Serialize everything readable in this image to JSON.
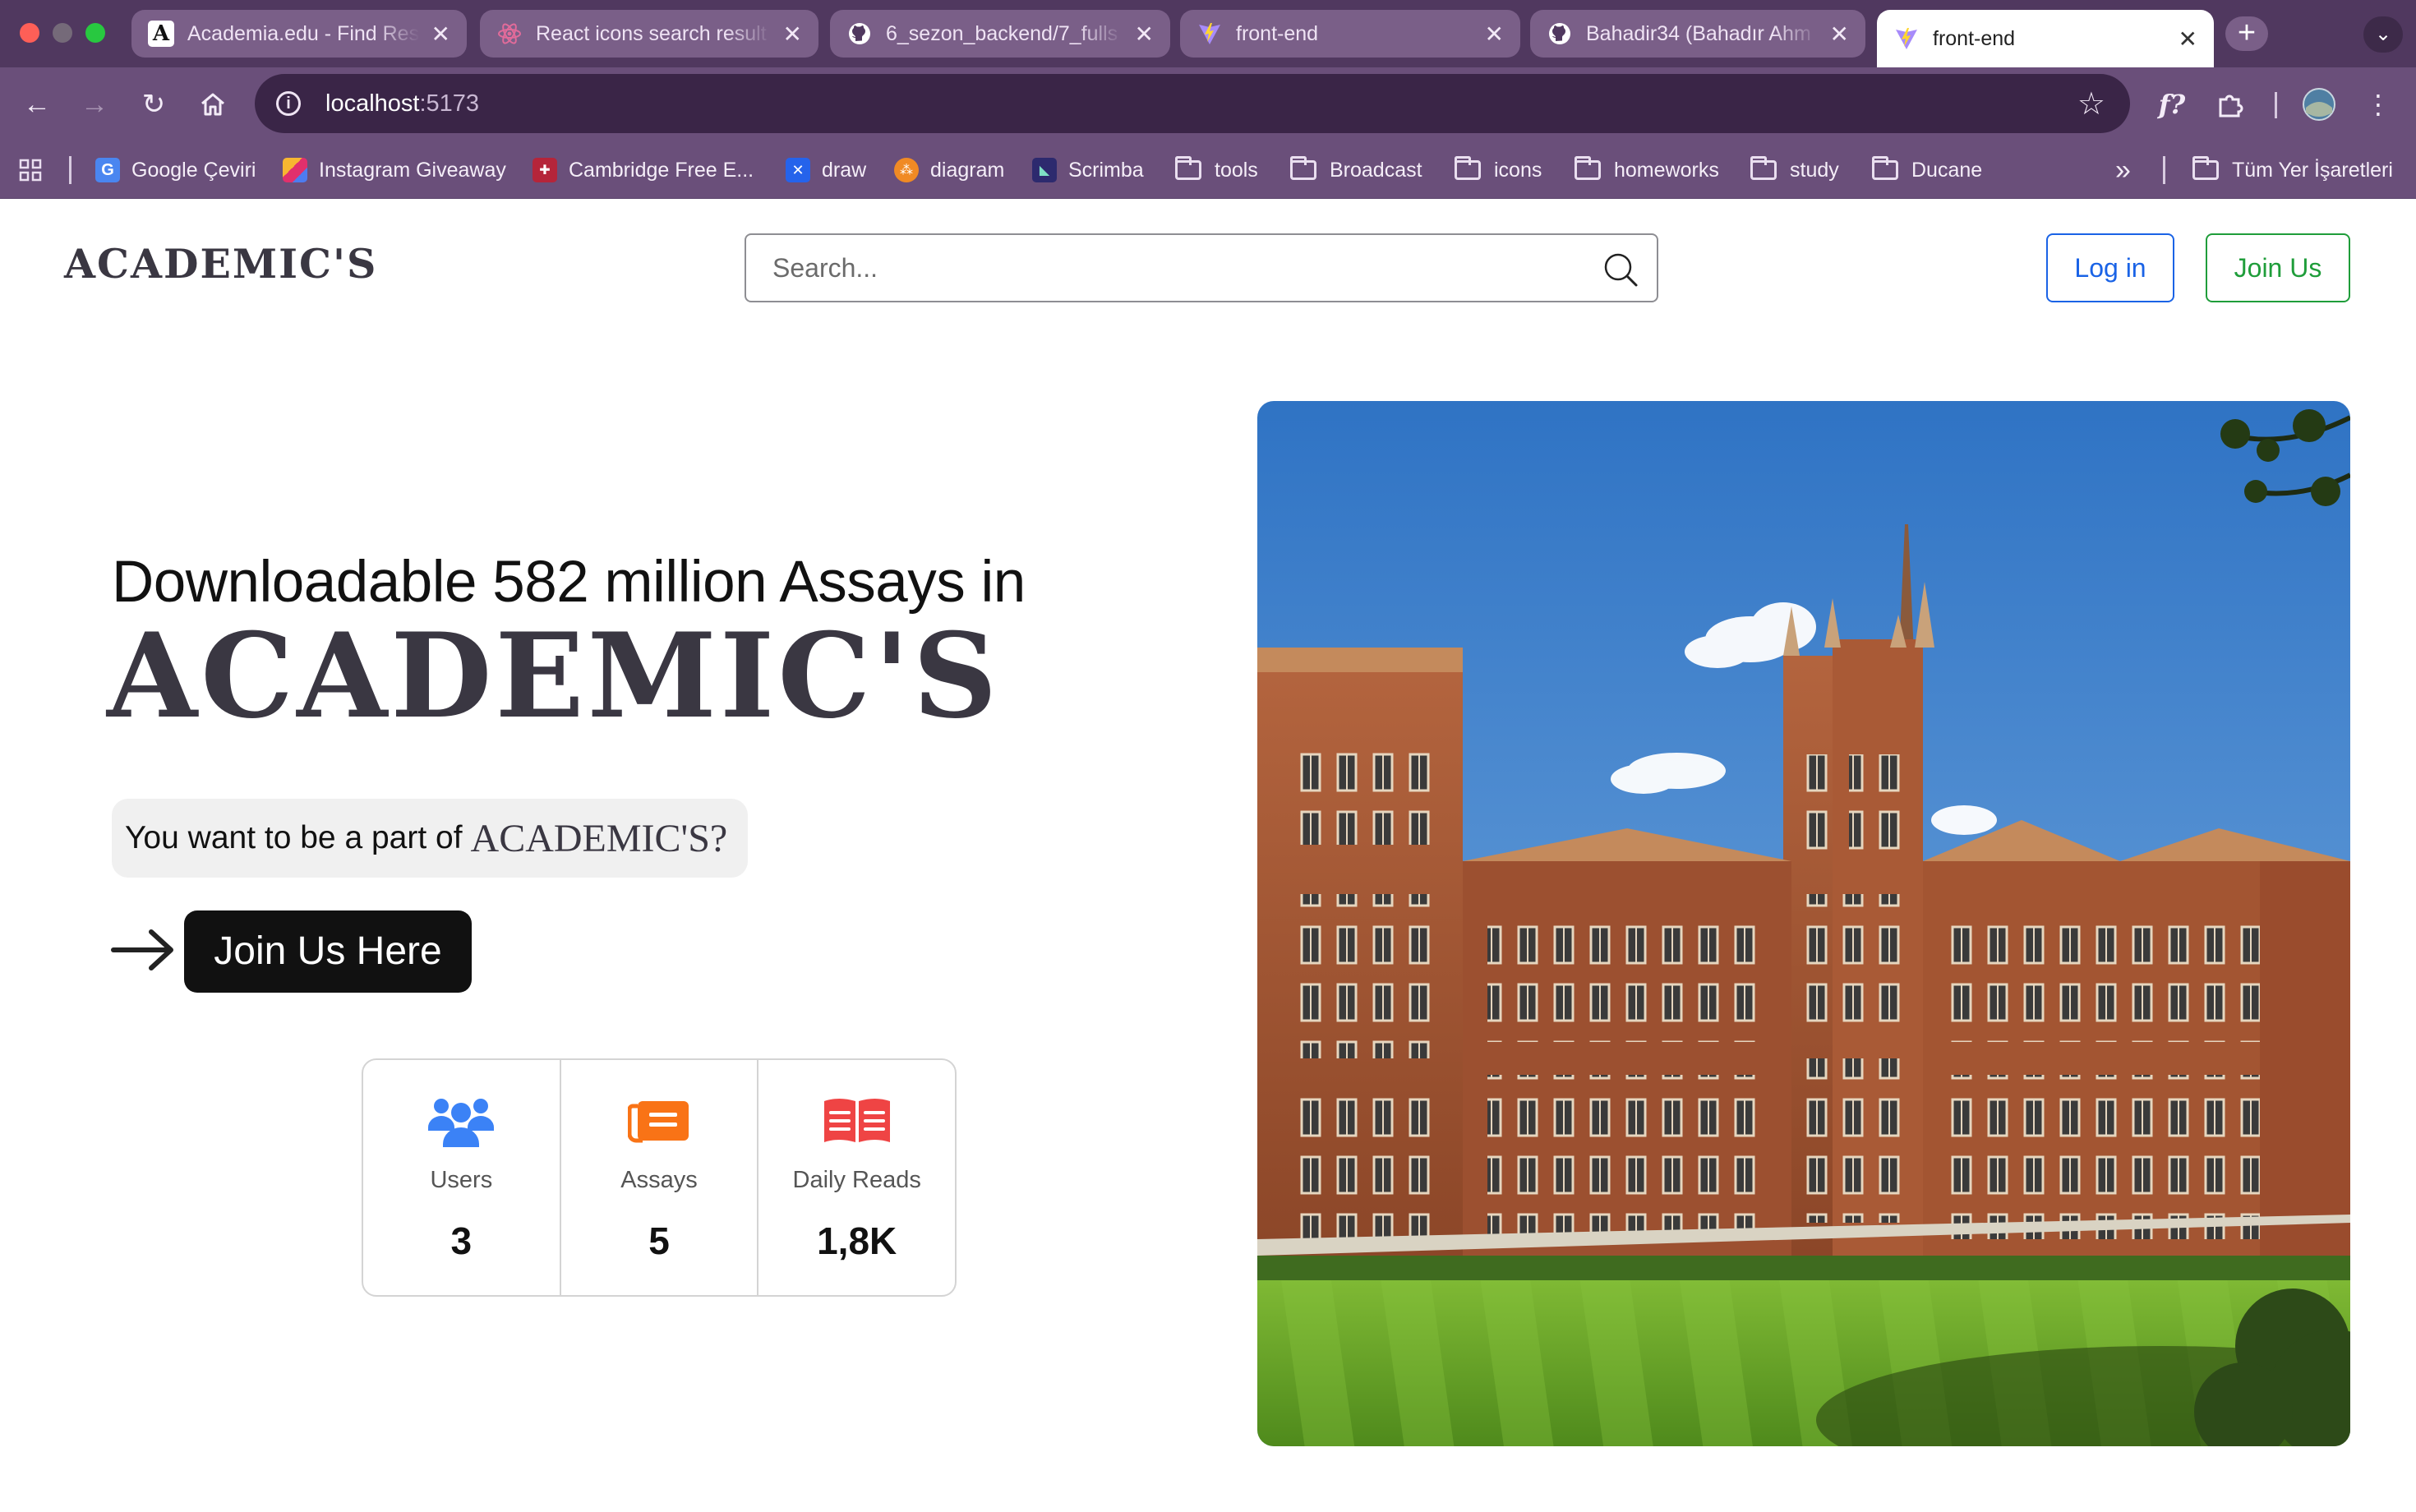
{
  "browser": {
    "tabs": [
      {
        "title": "Academia.edu - Find Res",
        "icon": "academia-icon"
      },
      {
        "title": "React icons search result",
        "icon": "react-icon"
      },
      {
        "title": "6_sezon_backend/7_fulls",
        "icon": "github-icon"
      },
      {
        "title": "front-end",
        "icon": "vite-icon"
      },
      {
        "title": "Bahadir34 (Bahadır Ahm",
        "icon": "github-icon"
      },
      {
        "title": "front-end",
        "icon": "vite-icon"
      }
    ],
    "close_glyph": "✕",
    "new_tab_glyph": "+",
    "url_host": "localhost",
    "url_port": ":5173",
    "bookmarks": [
      {
        "label": "Google Çeviri",
        "icon": "google-translate-icon"
      },
      {
        "label": "Instagram Giveaway",
        "icon": "instagram-icon"
      },
      {
        "label": "Cambridge Free E...",
        "icon": "cambridge-icon"
      },
      {
        "label": "draw",
        "icon": "drawio-icon"
      },
      {
        "label": "diagram",
        "icon": "diagram-icon"
      },
      {
        "label": "Scrimba",
        "icon": "scrimba-icon"
      },
      {
        "label": "tools",
        "icon": "folder-icon"
      },
      {
        "label": "Broadcast",
        "icon": "folder-icon"
      },
      {
        "label": "icons",
        "icon": "folder-icon"
      },
      {
        "label": "homeworks",
        "icon": "folder-icon"
      },
      {
        "label": "study",
        "icon": "folder-icon"
      },
      {
        "label": "Ducane",
        "icon": "folder-icon"
      }
    ],
    "more_bookmarks_glyph": "»",
    "all_bookmarks_label": "Tüm Yer İşaretleri"
  },
  "header": {
    "brand": "ACADEMIC'S",
    "search_placeholder": "Search...",
    "login_label": "Log in",
    "join_label": "Join Us"
  },
  "hero": {
    "subtitle": "Downloadable 582 million Assays in",
    "title": "ACADEMIC'S",
    "question_prefix": "You want to be a part of",
    "question_brand": "ACADEMIC'S?",
    "cta_label": "Join Us Here"
  },
  "stats": [
    {
      "label": "Users",
      "value": "3",
      "icon": "users-icon",
      "color": "#3b82f6"
    },
    {
      "label": "Assays",
      "value": "5",
      "icon": "newspaper-icon",
      "color": "#f97316"
    },
    {
      "label": "Daily Reads",
      "value": "1,8K",
      "icon": "open-book-icon",
      "color": "#ef4444"
    }
  ],
  "colors": {
    "browser_frame": "#50385f",
    "login_blue": "#1a63e6",
    "join_green": "#1f9d3a",
    "brand_text": "#3a3742",
    "cta_background": "#111111"
  }
}
